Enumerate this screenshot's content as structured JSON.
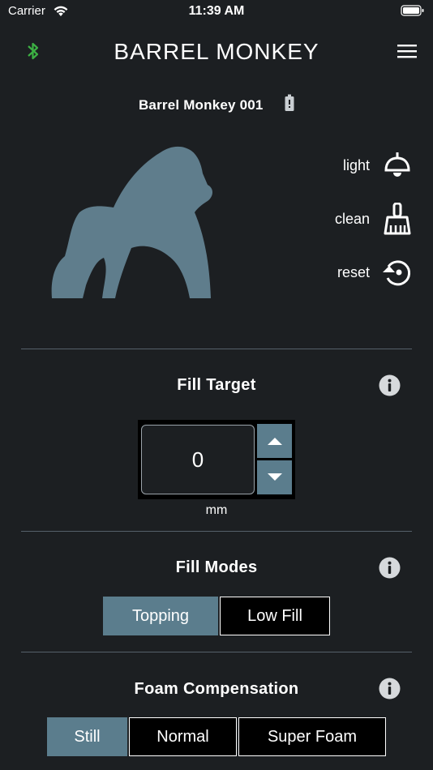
{
  "status_bar": {
    "carrier": "Carrier",
    "time": "11:39 AM"
  },
  "nav": {
    "title": "BARREL MONKEY",
    "bluetooth_icon": "bluetooth-icon",
    "menu_icon": "hamburger-menu-icon",
    "bluetooth_color": "#3cb043"
  },
  "device": {
    "name": "Barrel Monkey 001",
    "battery_icon": "battery-icon"
  },
  "actions": [
    {
      "label": "light",
      "icon": "lamp-icon"
    },
    {
      "label": "clean",
      "icon": "brush-icon"
    },
    {
      "label": "reset",
      "icon": "reset-icon"
    }
  ],
  "fill_target": {
    "title": "Fill Target",
    "value": "0",
    "unit": "mm"
  },
  "fill_modes": {
    "title": "Fill Modes",
    "options": [
      "Topping",
      "Low Fill"
    ],
    "selected": "Topping"
  },
  "foam_compensation": {
    "title": "Foam Compensation",
    "options": [
      "Still",
      "Normal",
      "Super Foam"
    ],
    "selected": "Still"
  },
  "colors": {
    "background": "#1c1f22",
    "accent": "#5b7d8d",
    "gorilla": "#5f7d8c"
  }
}
